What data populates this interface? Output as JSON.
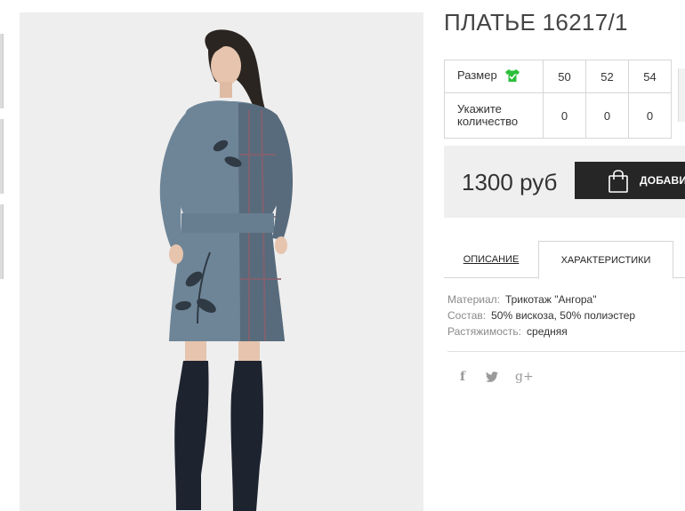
{
  "product": {
    "title": "ПЛАТЬЕ 16217/1",
    "photo_icon": "product-photo"
  },
  "sizes": {
    "size_label": "Размер",
    "size_icon": "tshirt-check-icon",
    "size_icon_color": "#2bbf3a",
    "quantity_label": "Укажите количество",
    "items": [
      {
        "size": "50",
        "quantity": "0"
      },
      {
        "size": "52",
        "quantity": "0"
      },
      {
        "size": "54",
        "quantity": "0"
      }
    ]
  },
  "buy": {
    "price": "1300 руб",
    "add_label": "ДОБАВИТ",
    "add_icon": "shopping-bag-icon"
  },
  "tabs": [
    {
      "label": "ОПИСАНИЕ",
      "active": false
    },
    {
      "label": "ХАРАКТЕРИСТИКИ",
      "active": true
    }
  ],
  "specs": [
    {
      "name": "Материал:",
      "value": "Трикотаж \"Ангора\""
    },
    {
      "name": "Состав:",
      "value": "50% вискоза, 50% полиэстер"
    },
    {
      "name": "Растяжимость:",
      "value": "средняя"
    }
  ],
  "social": {
    "facebook": "f",
    "twitter": "twitter-icon",
    "google_plus": "g+"
  },
  "colors": {
    "button_bg": "#262626",
    "panel_bg": "#efefef",
    "photo_bg": "#eeeeee",
    "dress": "#6e8598"
  }
}
